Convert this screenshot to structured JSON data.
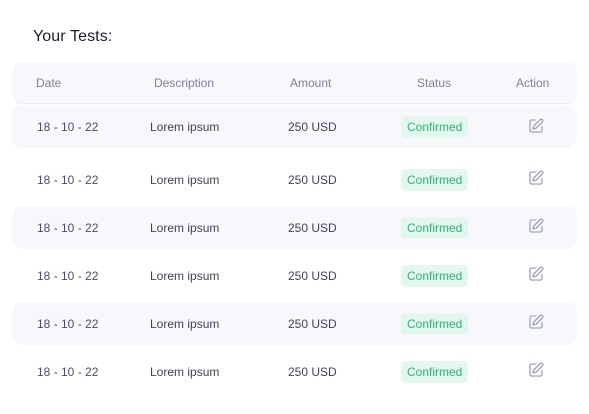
{
  "page": {
    "title": "Your Tests:"
  },
  "table": {
    "headers": {
      "date": "Date",
      "description": "Description",
      "amount": "Amount",
      "status": "Status",
      "action": "Action"
    },
    "rows": [
      {
        "date": "18 - 10 - 22",
        "description": "Lorem ipsum",
        "amount": "250 USD",
        "status": "Confirmed",
        "action_icon": "edit-icon"
      },
      {
        "date": "18 - 10 - 22",
        "description": "Lorem ipsum",
        "amount": "250 USD",
        "status": "Confirmed",
        "action_icon": "edit-icon"
      },
      {
        "date": "18 - 10 - 22",
        "description": "Lorem ipsum",
        "amount": "250 USD",
        "status": "Confirmed",
        "action_icon": "edit-icon"
      },
      {
        "date": "18 - 10 - 22",
        "description": "Lorem ipsum",
        "amount": "250 USD",
        "status": "Confirmed",
        "action_icon": "edit-icon"
      },
      {
        "date": "18 - 10 - 22",
        "description": "Lorem ipsum",
        "amount": "250 USD",
        "status": "Confirmed",
        "action_icon": "edit-icon"
      },
      {
        "date": "18 - 10 - 22",
        "description": "Lorem ipsum",
        "amount": "250 USD",
        "status": "Confirmed",
        "action_icon": "edit-icon"
      }
    ]
  },
  "colors": {
    "row_shade": "#f7f7fc",
    "status_bg": "#e4f7ef",
    "status_text": "#2bb37a",
    "icon": "#a1a5b7"
  }
}
